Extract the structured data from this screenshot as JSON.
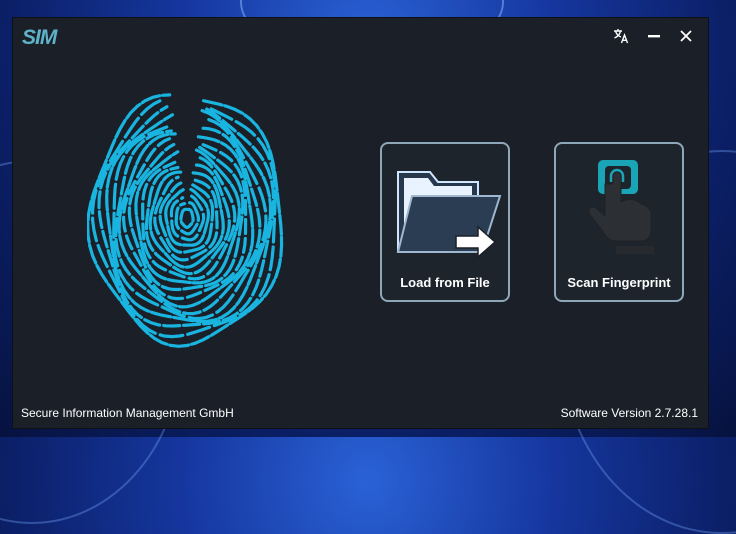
{
  "app": {
    "logo_text": "SIM",
    "brand_color": "#5fb3c8",
    "accent_color": "#19b4e0"
  },
  "window_controls": {
    "translate_icon": "translate-icon",
    "minimize_icon": "minimize-icon",
    "close_icon": "close-icon"
  },
  "actions": {
    "load_label": "Load from File",
    "scan_label": "Scan Fingerprint"
  },
  "footer": {
    "company": "Secure Information Management GmbH",
    "version": "Software Version 2.7.28.1"
  }
}
